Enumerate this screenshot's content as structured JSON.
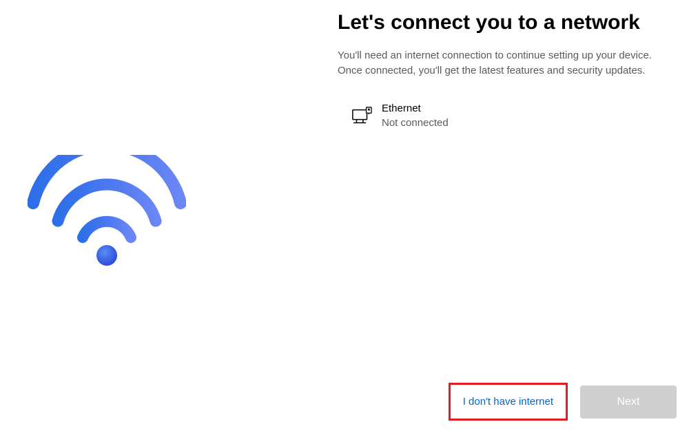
{
  "title": "Let's connect you to a network",
  "description": "You'll need an internet connection to continue setting up your device. Once connected, you'll get the latest features and security updates.",
  "network": {
    "name": "Ethernet",
    "status": "Not connected"
  },
  "buttons": {
    "no_internet": "I don't have internet",
    "next": "Next"
  }
}
